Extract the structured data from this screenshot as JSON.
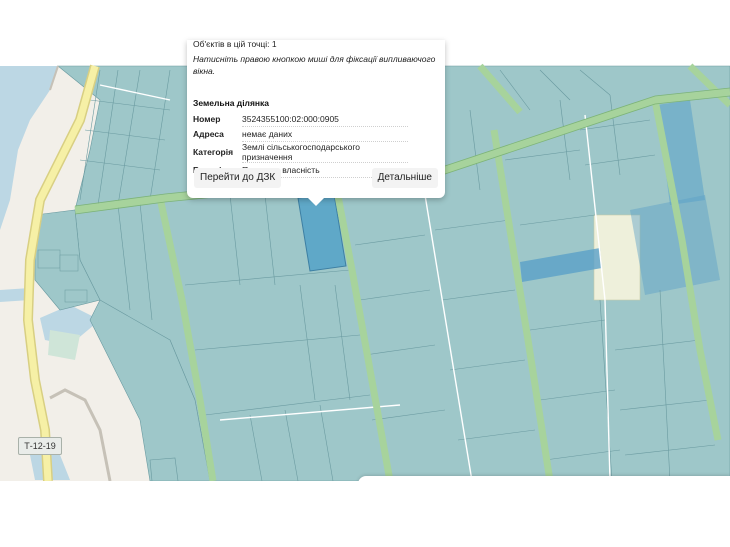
{
  "map": {
    "road_label": "Т-12-19",
    "colors": {
      "background": "#f2efe9",
      "water": "#bcd7e4",
      "parcel_fill": "#9ec7c9",
      "parcel_line": "#6a9aa0",
      "forest_belt": "#a7d39c",
      "road_fill": "#f6f0a6",
      "road_outline": "#d8cf82",
      "meadow": "#eef0db",
      "selected_parcel": "#5fa8c8",
      "highlight_parcel": "#5aa0c8"
    }
  },
  "popup": {
    "clipped_line": "Об'єктів в цій точці: 1",
    "hint": "Натисніть правою кнопкою миші для фіксації випливаючого вікна.",
    "section_title": "Земельна ділянка",
    "rows": [
      {
        "key": "Номер",
        "value": "3524355100:02:000:0905"
      },
      {
        "key": "Адреса",
        "value": "немає даних"
      },
      {
        "key": "Категорія",
        "value": "Землі сільськогосподарського призначення"
      },
      {
        "key": "Власність",
        "value": "Приватна власність"
      }
    ],
    "buttons": {
      "dzk": "Перейти до ДЗК",
      "details": "Детальніше"
    }
  }
}
